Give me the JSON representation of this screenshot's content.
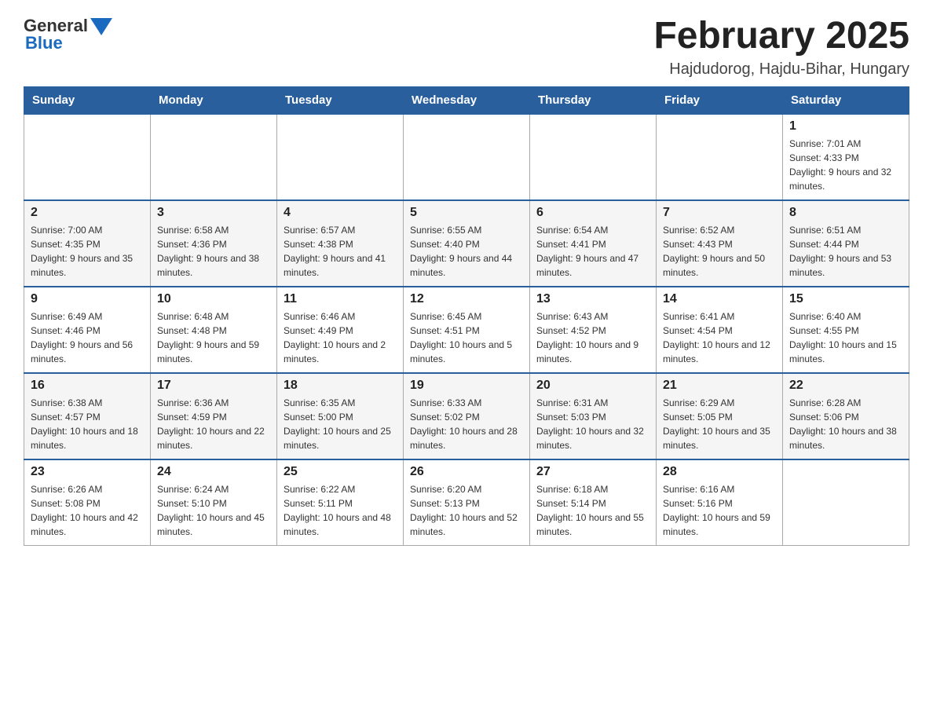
{
  "header": {
    "logo_general": "General",
    "logo_blue": "Blue",
    "month_title": "February 2025",
    "location": "Hajdudorog, Hajdu-Bihar, Hungary"
  },
  "days_of_week": [
    "Sunday",
    "Monday",
    "Tuesday",
    "Wednesday",
    "Thursday",
    "Friday",
    "Saturday"
  ],
  "weeks": [
    {
      "days": [
        {
          "number": "",
          "info": ""
        },
        {
          "number": "",
          "info": ""
        },
        {
          "number": "",
          "info": ""
        },
        {
          "number": "",
          "info": ""
        },
        {
          "number": "",
          "info": ""
        },
        {
          "number": "",
          "info": ""
        },
        {
          "number": "1",
          "info": "Sunrise: 7:01 AM\nSunset: 4:33 PM\nDaylight: 9 hours and 32 minutes."
        }
      ]
    },
    {
      "days": [
        {
          "number": "2",
          "info": "Sunrise: 7:00 AM\nSunset: 4:35 PM\nDaylight: 9 hours and 35 minutes."
        },
        {
          "number": "3",
          "info": "Sunrise: 6:58 AM\nSunset: 4:36 PM\nDaylight: 9 hours and 38 minutes."
        },
        {
          "number": "4",
          "info": "Sunrise: 6:57 AM\nSunset: 4:38 PM\nDaylight: 9 hours and 41 minutes."
        },
        {
          "number": "5",
          "info": "Sunrise: 6:55 AM\nSunset: 4:40 PM\nDaylight: 9 hours and 44 minutes."
        },
        {
          "number": "6",
          "info": "Sunrise: 6:54 AM\nSunset: 4:41 PM\nDaylight: 9 hours and 47 minutes."
        },
        {
          "number": "7",
          "info": "Sunrise: 6:52 AM\nSunset: 4:43 PM\nDaylight: 9 hours and 50 minutes."
        },
        {
          "number": "8",
          "info": "Sunrise: 6:51 AM\nSunset: 4:44 PM\nDaylight: 9 hours and 53 minutes."
        }
      ]
    },
    {
      "days": [
        {
          "number": "9",
          "info": "Sunrise: 6:49 AM\nSunset: 4:46 PM\nDaylight: 9 hours and 56 minutes."
        },
        {
          "number": "10",
          "info": "Sunrise: 6:48 AM\nSunset: 4:48 PM\nDaylight: 9 hours and 59 minutes."
        },
        {
          "number": "11",
          "info": "Sunrise: 6:46 AM\nSunset: 4:49 PM\nDaylight: 10 hours and 2 minutes."
        },
        {
          "number": "12",
          "info": "Sunrise: 6:45 AM\nSunset: 4:51 PM\nDaylight: 10 hours and 5 minutes."
        },
        {
          "number": "13",
          "info": "Sunrise: 6:43 AM\nSunset: 4:52 PM\nDaylight: 10 hours and 9 minutes."
        },
        {
          "number": "14",
          "info": "Sunrise: 6:41 AM\nSunset: 4:54 PM\nDaylight: 10 hours and 12 minutes."
        },
        {
          "number": "15",
          "info": "Sunrise: 6:40 AM\nSunset: 4:55 PM\nDaylight: 10 hours and 15 minutes."
        }
      ]
    },
    {
      "days": [
        {
          "number": "16",
          "info": "Sunrise: 6:38 AM\nSunset: 4:57 PM\nDaylight: 10 hours and 18 minutes."
        },
        {
          "number": "17",
          "info": "Sunrise: 6:36 AM\nSunset: 4:59 PM\nDaylight: 10 hours and 22 minutes."
        },
        {
          "number": "18",
          "info": "Sunrise: 6:35 AM\nSunset: 5:00 PM\nDaylight: 10 hours and 25 minutes."
        },
        {
          "number": "19",
          "info": "Sunrise: 6:33 AM\nSunset: 5:02 PM\nDaylight: 10 hours and 28 minutes."
        },
        {
          "number": "20",
          "info": "Sunrise: 6:31 AM\nSunset: 5:03 PM\nDaylight: 10 hours and 32 minutes."
        },
        {
          "number": "21",
          "info": "Sunrise: 6:29 AM\nSunset: 5:05 PM\nDaylight: 10 hours and 35 minutes."
        },
        {
          "number": "22",
          "info": "Sunrise: 6:28 AM\nSunset: 5:06 PM\nDaylight: 10 hours and 38 minutes."
        }
      ]
    },
    {
      "days": [
        {
          "number": "23",
          "info": "Sunrise: 6:26 AM\nSunset: 5:08 PM\nDaylight: 10 hours and 42 minutes."
        },
        {
          "number": "24",
          "info": "Sunrise: 6:24 AM\nSunset: 5:10 PM\nDaylight: 10 hours and 45 minutes."
        },
        {
          "number": "25",
          "info": "Sunrise: 6:22 AM\nSunset: 5:11 PM\nDaylight: 10 hours and 48 minutes."
        },
        {
          "number": "26",
          "info": "Sunrise: 6:20 AM\nSunset: 5:13 PM\nDaylight: 10 hours and 52 minutes."
        },
        {
          "number": "27",
          "info": "Sunrise: 6:18 AM\nSunset: 5:14 PM\nDaylight: 10 hours and 55 minutes."
        },
        {
          "number": "28",
          "info": "Sunrise: 6:16 AM\nSunset: 5:16 PM\nDaylight: 10 hours and 59 minutes."
        },
        {
          "number": "",
          "info": ""
        }
      ]
    }
  ]
}
